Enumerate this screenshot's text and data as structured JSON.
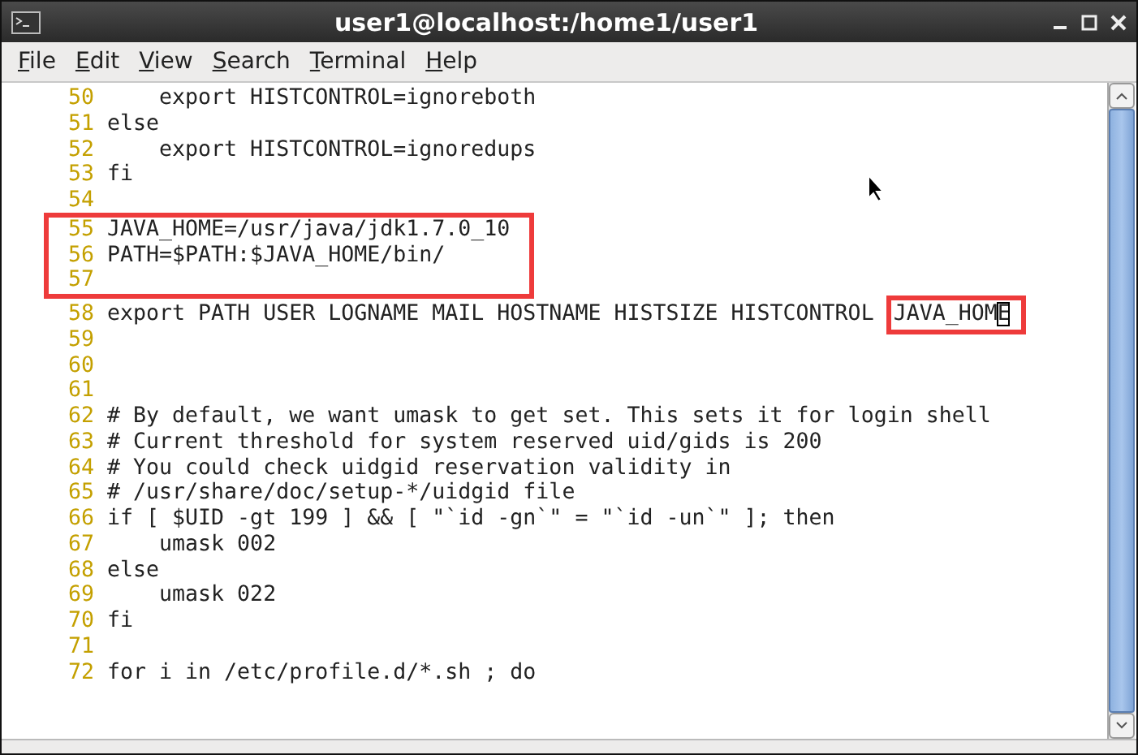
{
  "window": {
    "title": "user1@localhost:/home1/user1"
  },
  "menu": [
    "File",
    "Edit",
    "View",
    "Search",
    "Terminal",
    "Help"
  ],
  "lines": [
    {
      "number": "50",
      "segments": [
        {
          "kind": "plain",
          "text": "    export HISTCONTROL=ignoreboth"
        }
      ]
    },
    {
      "number": "51",
      "segments": [
        {
          "kind": "plain",
          "text": "else"
        }
      ]
    },
    {
      "number": "52",
      "segments": [
        {
          "kind": "plain",
          "text": "    export HISTCONTROL=ignoredups"
        }
      ]
    },
    {
      "number": "53",
      "segments": [
        {
          "kind": "plain",
          "text": "fi"
        }
      ]
    },
    {
      "number": "54"
    },
    {
      "number": "55",
      "boxed": true,
      "segments": [
        {
          "kind": "plain",
          "text": "JAVA_HOME=/usr/java/jdk1.7.0_10"
        }
      ]
    },
    {
      "number": "56",
      "boxed": true,
      "segments": [
        {
          "kind": "plain",
          "text": "PATH=$PATH:$JAVA_HOME/bin/"
        }
      ]
    },
    {
      "number": "57",
      "boxed": true
    },
    {
      "number": "58",
      "segments": [
        {
          "kind": "plain",
          "text": "export PATH USER LOGNAME MAIL HOSTNAME HISTSIZE HISTCONTROL "
        },
        {
          "kind": "boxed",
          "text": "JAVA_HOM"
        },
        {
          "kind": "cursor",
          "text": "E"
        }
      ]
    },
    {
      "number": "59"
    },
    {
      "number": "60"
    },
    {
      "number": "61"
    },
    {
      "number": "62",
      "segments": [
        {
          "kind": "plain",
          "text": "# By default, we want umask to get set. This sets it for login shell"
        }
      ]
    },
    {
      "number": "63",
      "segments": [
        {
          "kind": "plain",
          "text": "# Current threshold for system reserved uid/gids is 200"
        }
      ]
    },
    {
      "number": "64",
      "segments": [
        {
          "kind": "plain",
          "text": "# You could check uidgid reservation validity in"
        }
      ]
    },
    {
      "number": "65",
      "segments": [
        {
          "kind": "plain",
          "text": "# /usr/share/doc/setup-*/uidgid file"
        }
      ]
    },
    {
      "number": "66",
      "segments": [
        {
          "kind": "plain",
          "text": "if [ $UID -gt 199 ] && [ \"`id -gn`\" = \"`id -un`\" ]; then"
        }
      ]
    },
    {
      "number": "67",
      "segments": [
        {
          "kind": "plain",
          "text": "    umask 002"
        }
      ]
    },
    {
      "number": "68",
      "segments": [
        {
          "kind": "plain",
          "text": "else"
        }
      ]
    },
    {
      "number": "69",
      "segments": [
        {
          "kind": "plain",
          "text": "    umask 022"
        }
      ]
    },
    {
      "number": "70",
      "segments": [
        {
          "kind": "plain",
          "text": "fi"
        }
      ]
    },
    {
      "number": "71"
    },
    {
      "number": "72",
      "segments": [
        {
          "kind": "plain",
          "text": "for i in /etc/profile.d/*.sh ; do"
        }
      ]
    }
  ]
}
